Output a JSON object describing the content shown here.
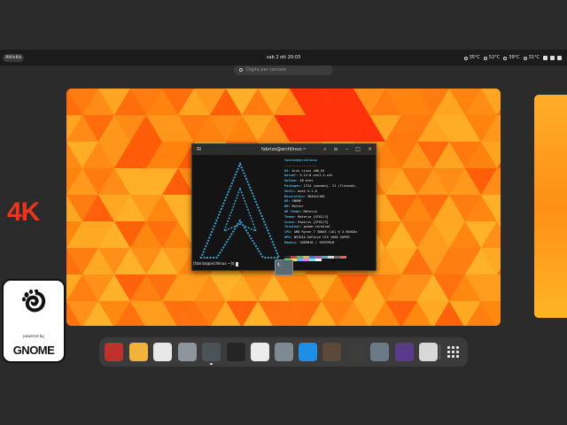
{
  "topbar": {
    "activities_label": "Attività",
    "clock": "sab 2 ott  20:03",
    "temps": [
      "35°C",
      "52°C",
      "39°C",
      "31°C"
    ]
  },
  "search": {
    "placeholder": "Digita per cercare"
  },
  "overlay": {
    "resolution_label": "4K"
  },
  "gnome_badge": {
    "powered_by": "powered by",
    "wordmark": "GNOME"
  },
  "terminal": {
    "title": "fabrizo@archlinux:~",
    "info_header": "fabrizo@archlinux",
    "info_separator": "-----------------",
    "info": [
      {
        "key": "OS",
        "value": "Arch Linux x86_64"
      },
      {
        "key": "Kernel",
        "value": "5.14.8-zen1-1-zen"
      },
      {
        "key": "Uptime",
        "value": "48 mins"
      },
      {
        "key": "Packages",
        "value": "1314 (pacman), 21 (flatpak),"
      },
      {
        "key": "Shell",
        "value": "bash 5.1.8"
      },
      {
        "key": "Resolution",
        "value": "3840x2160"
      },
      {
        "key": "DE",
        "value": "GNOME"
      },
      {
        "key": "WM",
        "value": "Mutter"
      },
      {
        "key": "WM Theme",
        "value": "Materia"
      },
      {
        "key": "Theme",
        "value": "Materia [GTK2/3]"
      },
      {
        "key": "Icons",
        "value": "Papirus [GTK2/3]"
      },
      {
        "key": "Terminal",
        "value": "gnome-terminal"
      },
      {
        "key": "CPU",
        "value": "AMD Ryzen 7 3800X (16) @ 3.900GHz"
      },
      {
        "key": "GPU",
        "value": "NVIDIA GeForce GTX 1660 SUPER"
      },
      {
        "key": "Memory",
        "value": "1869MiB / 15997MiB"
      }
    ],
    "prompt": "[fabrizo@archlinux ~]$ ",
    "swatch_colors": [
      "#2e2e2e",
      "#d33b3b",
      "#4fb84f",
      "#d7b93a",
      "#3b7bd6",
      "#b94fc2",
      "#41b6c4",
      "#d8d8d8",
      "#6a6a6a",
      "#ff5b5b",
      "#7fe07f",
      "#ffe06a",
      "#6fa8ff",
      "#e07fe8",
      "#7fe4f0",
      "#ffffff"
    ]
  },
  "thumbnail_label": "$_",
  "dock": {
    "apps": [
      {
        "name": "rhythmbox",
        "color": "#c0312b"
      },
      {
        "name": "mail",
        "color": "#f2b33a"
      },
      {
        "name": "chrome",
        "color": "#e8e8e8"
      },
      {
        "name": "files",
        "color": "#8e959c"
      },
      {
        "name": "terminal",
        "color": "#4a5358",
        "running": true
      },
      {
        "name": "system-monitor",
        "color": "#252525"
      },
      {
        "name": "text-editor",
        "color": "#ececec"
      },
      {
        "name": "settings",
        "color": "#7e8a92"
      },
      {
        "name": "downloader",
        "color": "#1f8ee6"
      },
      {
        "name": "gimp",
        "color": "#5b4a3a"
      },
      {
        "name": "keyboard-app",
        "color": "#3c3c3c"
      },
      {
        "name": "passwords",
        "color": "#6c7a85"
      },
      {
        "name": "purple-app",
        "color": "#5a3a8a"
      },
      {
        "name": "audio-mixer",
        "color": "#d8d8d8"
      }
    ]
  }
}
